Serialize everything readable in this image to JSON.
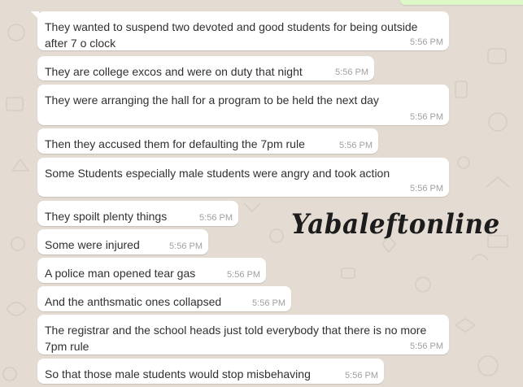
{
  "chat": {
    "messages": [
      {
        "text": "They wanted to suspend two devoted and good students for being outside after 7 o clock",
        "time": "5:56 PM"
      },
      {
        "text": "They are college excos and were on duty that night",
        "time": "5:56 PM"
      },
      {
        "text": "They were arranging the hall for a program to be held the next day",
        "time": "5:56 PM"
      },
      {
        "text": "Then they accused them for defaulting the 7pm rule",
        "time": "5:56 PM"
      },
      {
        "text": "Some Students especially male students were angry and took action",
        "time": "5:56 PM"
      },
      {
        "text": "They spoilt plenty things",
        "time": "5:56 PM"
      },
      {
        "text": "Some were injured",
        "time": "5:56 PM"
      },
      {
        "text": "A police man opened tear gas",
        "time": "5:56 PM"
      },
      {
        "text": "And the anthsmatic ones collapsed",
        "time": "5:56 PM"
      },
      {
        "text": "The registrar and the school heads just told everybody that there is no more 7pm rule",
        "time": "5:56 PM"
      },
      {
        "text": "So that those male students would stop misbehaving",
        "time": "5:56 PM"
      }
    ]
  },
  "watermark": {
    "text": "Yabaleftonline"
  },
  "colors": {
    "background": "#e4dcd3",
    "incoming_bubble": "#ffffff",
    "outgoing_bubble": "#dcf8c6",
    "message_text": "#303030",
    "timestamp": "#a0a0a0"
  }
}
